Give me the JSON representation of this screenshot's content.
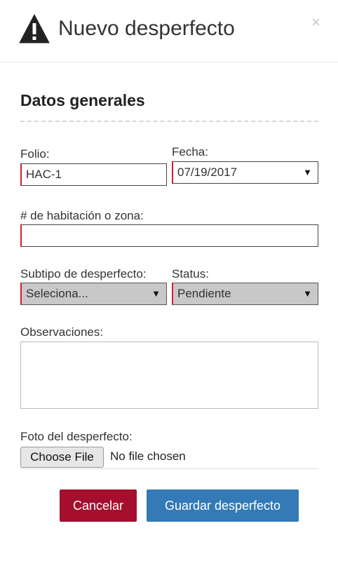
{
  "modal": {
    "title": "Nuevo desperfecto",
    "close_label": "×"
  },
  "section": {
    "title": "Datos generales"
  },
  "form": {
    "folio": {
      "label": "Folio:",
      "value": "HAC-1"
    },
    "fecha": {
      "label": "Fecha:",
      "value": "07/19/2017"
    },
    "habitacion": {
      "label": "# de habitación o zona:",
      "value": ""
    },
    "subtipo": {
      "label": "Subtipo de desperfecto:",
      "value": "Seleciona..."
    },
    "status": {
      "label": "Status:",
      "value": "Pendiente"
    },
    "observaciones": {
      "label": "Observaciones:",
      "value": ""
    },
    "foto": {
      "label": "Foto del desperfecto:",
      "button": "Choose File",
      "status": "No file chosen"
    }
  },
  "actions": {
    "cancel": "Cancelar",
    "save": "Guardar desperfecto"
  },
  "icons": {
    "warning": "warning-triangle-icon",
    "caret": "▼"
  },
  "colors": {
    "required_accent": "#d0202d",
    "cancel_bg": "#a50e2d",
    "save_bg": "#337ab7"
  }
}
